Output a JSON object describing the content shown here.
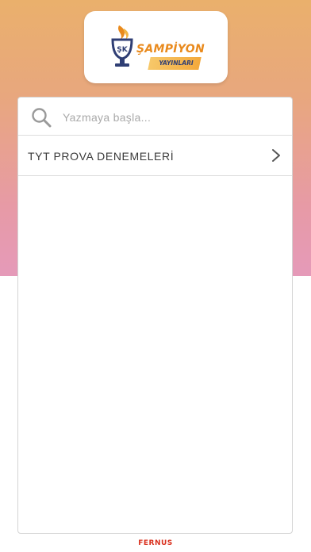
{
  "logo": {
    "brand_name": "ŞAMPİYON",
    "subtitle": "YAYINLARI",
    "emblem_text": "ŞK"
  },
  "search": {
    "placeholder": "Yazmaya başla...",
    "value": "",
    "icon": "search-icon"
  },
  "list": {
    "items": [
      {
        "label": "TYT PROVA DENEMELERİ",
        "icon": "chevron-right-icon"
      }
    ]
  },
  "footer": {
    "text": "FERNUS"
  },
  "colors": {
    "gradient_top": "#eab06c",
    "gradient_bottom": "#e59ab9",
    "brand_orange": "#e98a1d",
    "brand_navy": "#2f3e74",
    "footer_red": "#d9301e"
  }
}
